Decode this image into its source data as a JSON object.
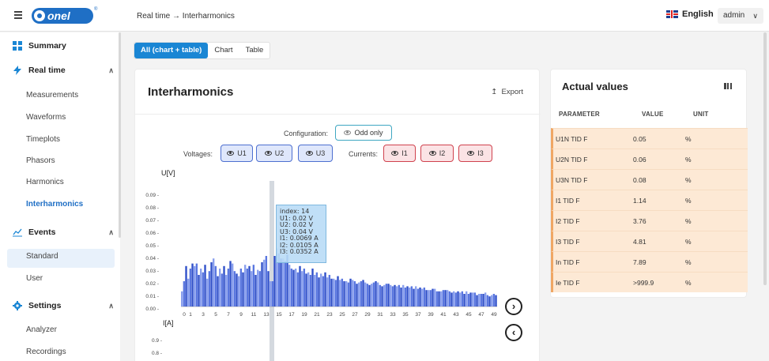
{
  "topbar": {
    "logo_text": "onel",
    "logo_reg": "®",
    "breadcrumb": "Real time → Interharmonics",
    "language": "English",
    "user": "admin"
  },
  "sidebar": {
    "summary": "Summary",
    "realtime": "Real time",
    "realtime_items": [
      "Measurements",
      "Waveforms",
      "Timeplots",
      "Phasors",
      "Harmonics",
      "Interharmonics"
    ],
    "events": "Events",
    "events_items": [
      "Standard",
      "User"
    ],
    "settings": "Settings",
    "settings_items": [
      "Analyzer",
      "Recordings"
    ],
    "active_item": "Interharmonics"
  },
  "tabs": {
    "all": "All (chart + table)",
    "chart": "Chart",
    "table": "Table",
    "active": "All (chart + table)"
  },
  "chart_card": {
    "title": "Interharmonics",
    "export_label": "Export",
    "config_label": "Configuration:",
    "odd_only_label": "Odd only",
    "voltages_label": "Voltages:",
    "currents_label": "Currents:",
    "voltage_buttons": [
      "U1",
      "U2",
      "U3"
    ],
    "current_buttons": [
      "I1",
      "I2",
      "I3"
    ],
    "voltage_unit": "U[V]",
    "current_unit": "I[A]"
  },
  "tooltip": {
    "lines": [
      "index: 14",
      "U1: 0.02 V",
      "U2: 0.02 V",
      "U3: 0.04 V",
      "I1: 0.0069 A",
      "I2: 0.0105 A",
      "I3: 0.0352 A"
    ]
  },
  "chart_data": [
    {
      "type": "bar",
      "ylabel": "U[V]",
      "ylim": [
        0,
        0.09
      ],
      "yticks": [
        "0.00",
        "0.01",
        "0.02",
        "0.03",
        "0.04",
        "0.05",
        "0.06",
        "0.07",
        "0.08",
        "0.09"
      ],
      "x_tick_labels": [
        "0",
        "1",
        "3",
        "5",
        "7",
        "9",
        "11",
        "13",
        "15",
        "17",
        "19",
        "21",
        "23",
        "25",
        "27",
        "29",
        "31",
        "33",
        "35",
        "37",
        "39",
        "41",
        "43",
        "45",
        "47",
        "49"
      ],
      "categories": [
        0,
        1,
        2,
        3,
        4,
        5,
        6,
        7,
        8,
        9,
        10,
        11,
        12,
        13,
        14,
        15,
        16,
        17,
        18,
        19,
        20,
        21,
        22,
        23,
        24,
        25,
        26,
        27,
        28,
        29,
        30,
        31,
        32,
        33,
        34,
        35,
        36,
        37,
        38,
        39,
        40,
        41,
        42,
        43,
        44,
        45,
        46,
        47,
        48,
        49
      ],
      "series": [
        {
          "name": "U1",
          "values": [
            0.012,
            0.022,
            0.032,
            0.03,
            0.022,
            0.038,
            0.03,
            0.025,
            0.034,
            0.024,
            0.033,
            0.028,
            0.029,
            0.037,
            0.02,
            0.046,
            0.038,
            0.033,
            0.03,
            0.028,
            0.027,
            0.025,
            0.026,
            0.023,
            0.022,
            0.021,
            0.02,
            0.021,
            0.019,
            0.019,
            0.018,
            0.019,
            0.017,
            0.017,
            0.016,
            0.017,
            0.015,
            0.016,
            0.014,
            0.013,
            0.014,
            0.012,
            0.013,
            0.012,
            0.011,
            0.012,
            0.011,
            0.01,
            0.011,
            0.009
          ]
        },
        {
          "name": "U2",
          "values": [
            0.02,
            0.03,
            0.034,
            0.027,
            0.028,
            0.032,
            0.026,
            0.03,
            0.028,
            0.03,
            0.03,
            0.033,
            0.028,
            0.04,
            0.02,
            0.042,
            0.036,
            0.03,
            0.027,
            0.03,
            0.025,
            0.027,
            0.024,
            0.025,
            0.021,
            0.022,
            0.019,
            0.02,
            0.02,
            0.018,
            0.019,
            0.017,
            0.018,
            0.016,
            0.017,
            0.015,
            0.016,
            0.014,
            0.015,
            0.013,
            0.012,
            0.013,
            0.012,
            0.011,
            0.012,
            0.01,
            0.011,
            0.01,
            0.009,
            0.01
          ]
        },
        {
          "name": "U3",
          "values": [
            0.032,
            0.034,
            0.025,
            0.033,
            0.035,
            0.024,
            0.032,
            0.036,
            0.026,
            0.027,
            0.032,
            0.025,
            0.035,
            0.028,
            0.04,
            0.038,
            0.041,
            0.029,
            0.032,
            0.026,
            0.03,
            0.023,
            0.027,
            0.022,
            0.024,
            0.02,
            0.022,
            0.018,
            0.021,
            0.017,
            0.02,
            0.016,
            0.018,
            0.017,
            0.015,
            0.016,
            0.014,
            0.015,
            0.013,
            0.014,
            0.012,
            0.013,
            0.011,
            0.012,
            0.01,
            0.011,
            0.009,
            0.01,
            0.008,
            0.009
          ]
        }
      ]
    },
    {
      "type": "bar",
      "ylabel": "I[A]",
      "yticks": [
        "0.8",
        "0.9"
      ],
      "series": []
    }
  ],
  "actual_values": {
    "title": "Actual values",
    "columns": [
      "PARAMETER",
      "VALUE",
      "UNIT"
    ],
    "rows": [
      {
        "parameter": "U1N TID F",
        "value": "0.05",
        "unit": "%"
      },
      {
        "parameter": "U2N TID F",
        "value": "0.06",
        "unit": "%"
      },
      {
        "parameter": "U3N TID F",
        "value": "0.08",
        "unit": "%"
      },
      {
        "parameter": "I1 TID F",
        "value": "1.14",
        "unit": "%"
      },
      {
        "parameter": "I2 TID F",
        "value": "3.76",
        "unit": "%"
      },
      {
        "parameter": "I3 TID F",
        "value": "4.81",
        "unit": "%"
      },
      {
        "parameter": "In TID F",
        "value": "7.89",
        "unit": "%"
      },
      {
        "parameter": "Ie TID F",
        "value": ">999.9",
        "unit": "%"
      }
    ]
  },
  "colors": {
    "accent": "#1a86d4",
    "voltage_bar_light": "#8aa0ee",
    "voltage_bar_mid": "#5a77e0",
    "voltage_bar_dark": "#2f4fc9",
    "row_bg": "#fde9d5",
    "row_border": "#f0a764"
  }
}
